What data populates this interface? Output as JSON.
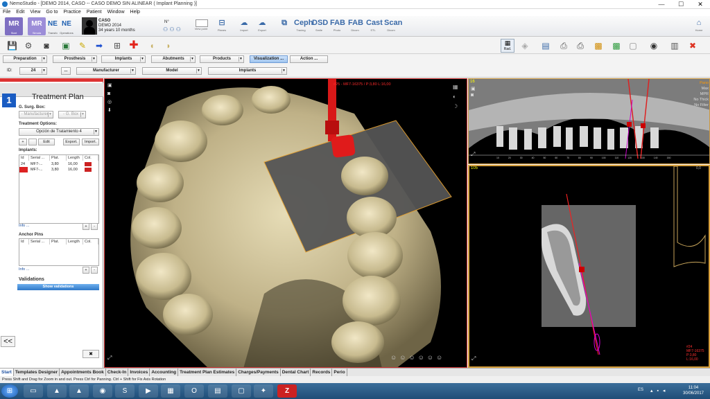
{
  "window": {
    "title": "NemoStudio - [DEMO 2014, CASO -- CASO DEMO SIN ALINEAR ( Implant Planning )]",
    "minimize": "—",
    "maximize": "☐",
    "close": "✕"
  },
  "menu": [
    "File",
    "Edit",
    "View",
    "Go to",
    "Practice",
    "Patient",
    "Window",
    "Help"
  ],
  "toolbar1": {
    "mr_label": "MR",
    "mr_sub": "Start",
    "mr2_label": "MR",
    "mr2_sub": "Simula",
    "ne1_label": "NE",
    "ne1_sub": "Transfo",
    "ne2_label": "NE",
    "ne2_sub": "Operations",
    "patient": {
      "last": "CASO",
      "first": "DEMO 2014",
      "age": "34 years 10 months",
      "n_label": "N°"
    },
    "view_point": "View point",
    "planes": "Planes",
    "import": "Import",
    "export": "Export",
    "ceph": {
      "title": "Ceph",
      "sub": "Tracing"
    },
    "dsd": {
      "title": "DSD",
      "sub": "Smile"
    },
    "fab1": {
      "title": "FAB",
      "sub": "Photo"
    },
    "fab2": {
      "title": "FAB",
      "sub": "Dicom"
    },
    "cast": {
      "title": "Cast",
      "sub": "STL"
    },
    "scan": {
      "title": "Scan",
      "sub": "Dicom"
    },
    "home": "Home"
  },
  "toolbar2": {
    "rad_label": "Rad."
  },
  "tabbar": [
    {
      "label": "Preparation"
    },
    {
      "label": "Prosthesis"
    },
    {
      "label": "Implants"
    },
    {
      "label": "Abutments"
    },
    {
      "label": "Products"
    },
    {
      "label": "Visualization ..."
    },
    {
      "label": "Action ..."
    }
  ],
  "filterbar": {
    "id_label": "ID:",
    "id_value": "24",
    "dots": "...",
    "manufacturer": "Manufacturer",
    "model": "Model",
    "implants": "Implants"
  },
  "panel": {
    "step": "1",
    "title": "Treatment Plan",
    "gsurg_label": "G. Surg. Box:",
    "manufacturer_ph": "- Manufacturer -",
    "gbox_ph": "- G. Box -",
    "options_label": "Treatment Options:",
    "option_value": "Opción de Tratamiento 4",
    "btn_plus": "+",
    "btn_edit": "Edit",
    "btn_export": "Export.",
    "btn_import": "Import.",
    "implants_label": "Implants:",
    "implant_cols": [
      "Id",
      "Serial ...",
      "Plat.",
      "Length",
      "Col."
    ],
    "implant_rows": [
      {
        "id": "24",
        "serial": "MF7-...",
        "plat": "3,80",
        "length": "16,00",
        "color": "#cc2222"
      },
      {
        "id": "25",
        "serial": "MF7-...",
        "plat": "3,80",
        "length": "16,00",
        "color": "#cc2222"
      }
    ],
    "info1": "Info ...",
    "anchor_label": "Anchor Pins",
    "anchor_cols": [
      "Id",
      "Serial ...",
      "Plat.",
      "Length",
      "Col."
    ],
    "info2": "Info ...",
    "validations_label": "Validations",
    "show_validations": "Show validations",
    "collapse": "<<",
    "close_x": "✖"
  },
  "view3d": {
    "implant_label": "#25 - MF7-16375 / P:3,80 L:16,00",
    "accent": "#ff2a2a"
  },
  "viewtop": {
    "number": "16",
    "options": [
      "Pano",
      "Max",
      "MPR",
      "No Thick",
      "No Filter"
    ],
    "scale": "10 20 30 40 50 60 70 80 90 100 110 120 130 140 150"
  },
  "viewbottom": {
    "number": "105",
    "corner": "0,0",
    "implant_info": [
      "#24",
      "MF7-16375",
      "P:3,80",
      "L:16,00"
    ]
  },
  "bottomtabs": [
    "Start",
    "Templates Designer",
    "Appointments Book",
    "Check-In",
    "Invoices",
    "Accounting",
    "Treatment Plan Estimates",
    "Charges/Payments",
    "Dental Chart",
    "Records",
    "Perio"
  ],
  "status": "Press Shift and Drag for Zoom in and out. Press Ctrl for Panning. Ctrl + Shift for Fix Axis Rotation",
  "taskbar": {
    "lang": "ES",
    "time": "11:04",
    "date": "30/06/2017"
  }
}
